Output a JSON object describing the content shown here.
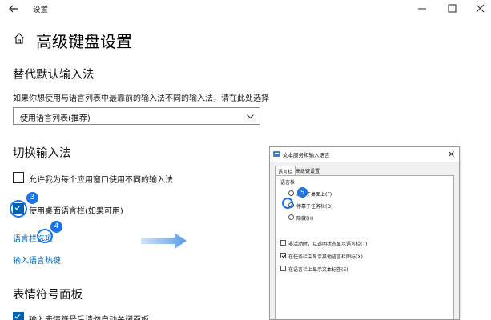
{
  "window": {
    "title": "设置"
  },
  "page": {
    "title": "高级键盘设置"
  },
  "override_section": {
    "heading": "替代默认输入法",
    "description": "如果你想使用与语言列表中最靠前的输入法不同的输入法，请在此处选择",
    "dropdown_value": "使用语言列表(推荐)"
  },
  "switch_section": {
    "heading": "切换输入法",
    "checkboxes": [
      {
        "label": "允许我为每个应用窗口使用不同的输入法",
        "checked": false
      },
      {
        "label": "使用桌面语言栏(如果可用)",
        "checked": true
      }
    ],
    "links": [
      "语言栏选项",
      "输入语言热键"
    ]
  },
  "emoji_section": {
    "heading": "表情符号面板",
    "checkbox_label": "输入表情符号后请勿自动关闭面板",
    "checked": true
  },
  "annotations": {
    "badge_3": "3",
    "badge_4": "4",
    "badge_5": "5",
    "accent": "#1a73e8"
  },
  "dialog": {
    "title": "文本服务和输入语言",
    "tabs": [
      "语言栏",
      "高级键设置"
    ],
    "group_label": "语言栏",
    "radios": [
      {
        "label": "悬浮于桌面上(F)",
        "checked": false
      },
      {
        "label": "停靠于任务栏(D)",
        "checked": true
      },
      {
        "label": "隐藏(H)",
        "checked": false
      }
    ],
    "checks": [
      {
        "label": "非活动时，以透明状态显示语言栏(T)",
        "checked": false
      },
      {
        "label": "在任务栏中显示其他语言栏图标(X)",
        "checked": true
      },
      {
        "label": "在语言栏上显示文本标签(E)",
        "checked": false
      }
    ]
  },
  "colors": {
    "accent": "#0063b1",
    "annotation": "#1a73e8"
  }
}
